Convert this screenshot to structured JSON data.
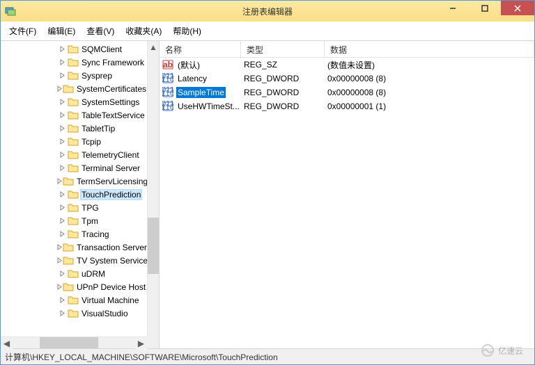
{
  "window": {
    "title": "注册表编辑器"
  },
  "menubar": [
    {
      "label": "文件(F)"
    },
    {
      "label": "编辑(E)"
    },
    {
      "label": "查看(V)"
    },
    {
      "label": "收藏夹(A)"
    },
    {
      "label": "帮助(H)"
    }
  ],
  "tree": {
    "selected_index": 11,
    "items": [
      {
        "label": "SQMClient"
      },
      {
        "label": "Sync Framework"
      },
      {
        "label": "Sysprep"
      },
      {
        "label": "SystemCertificates"
      },
      {
        "label": "SystemSettings"
      },
      {
        "label": "TableTextService"
      },
      {
        "label": "TabletTip"
      },
      {
        "label": "Tcpip"
      },
      {
        "label": "TelemetryClient"
      },
      {
        "label": "Terminal Server"
      },
      {
        "label": "TermServLicensing"
      },
      {
        "label": "TouchPrediction"
      },
      {
        "label": "TPG"
      },
      {
        "label": "Tpm"
      },
      {
        "label": "Tracing"
      },
      {
        "label": "Transaction Server"
      },
      {
        "label": "TV System Services"
      },
      {
        "label": "uDRM"
      },
      {
        "label": "UPnP Device Host"
      },
      {
        "label": "Virtual Machine"
      },
      {
        "label": "VisualStudio"
      }
    ]
  },
  "list": {
    "columns": {
      "name": "名称",
      "type": "类型",
      "data": "数据"
    },
    "selected_index": 2,
    "rows": [
      {
        "icon": "str",
        "name": "(默认)",
        "type": "REG_SZ",
        "data": "(数值未设置)"
      },
      {
        "icon": "bin",
        "name": "Latency",
        "type": "REG_DWORD",
        "data": "0x00000008 (8)"
      },
      {
        "icon": "bin",
        "name": "SampleTime",
        "type": "REG_DWORD",
        "data": "0x00000008 (8)"
      },
      {
        "icon": "bin",
        "name": "UseHWTimeSt...",
        "type": "REG_DWORD",
        "data": "0x00000001 (1)"
      }
    ]
  },
  "statusbar": {
    "path": "计算机\\HKEY_LOCAL_MACHINE\\SOFTWARE\\Microsoft\\TouchPrediction"
  },
  "watermark": {
    "text": "亿速云"
  }
}
